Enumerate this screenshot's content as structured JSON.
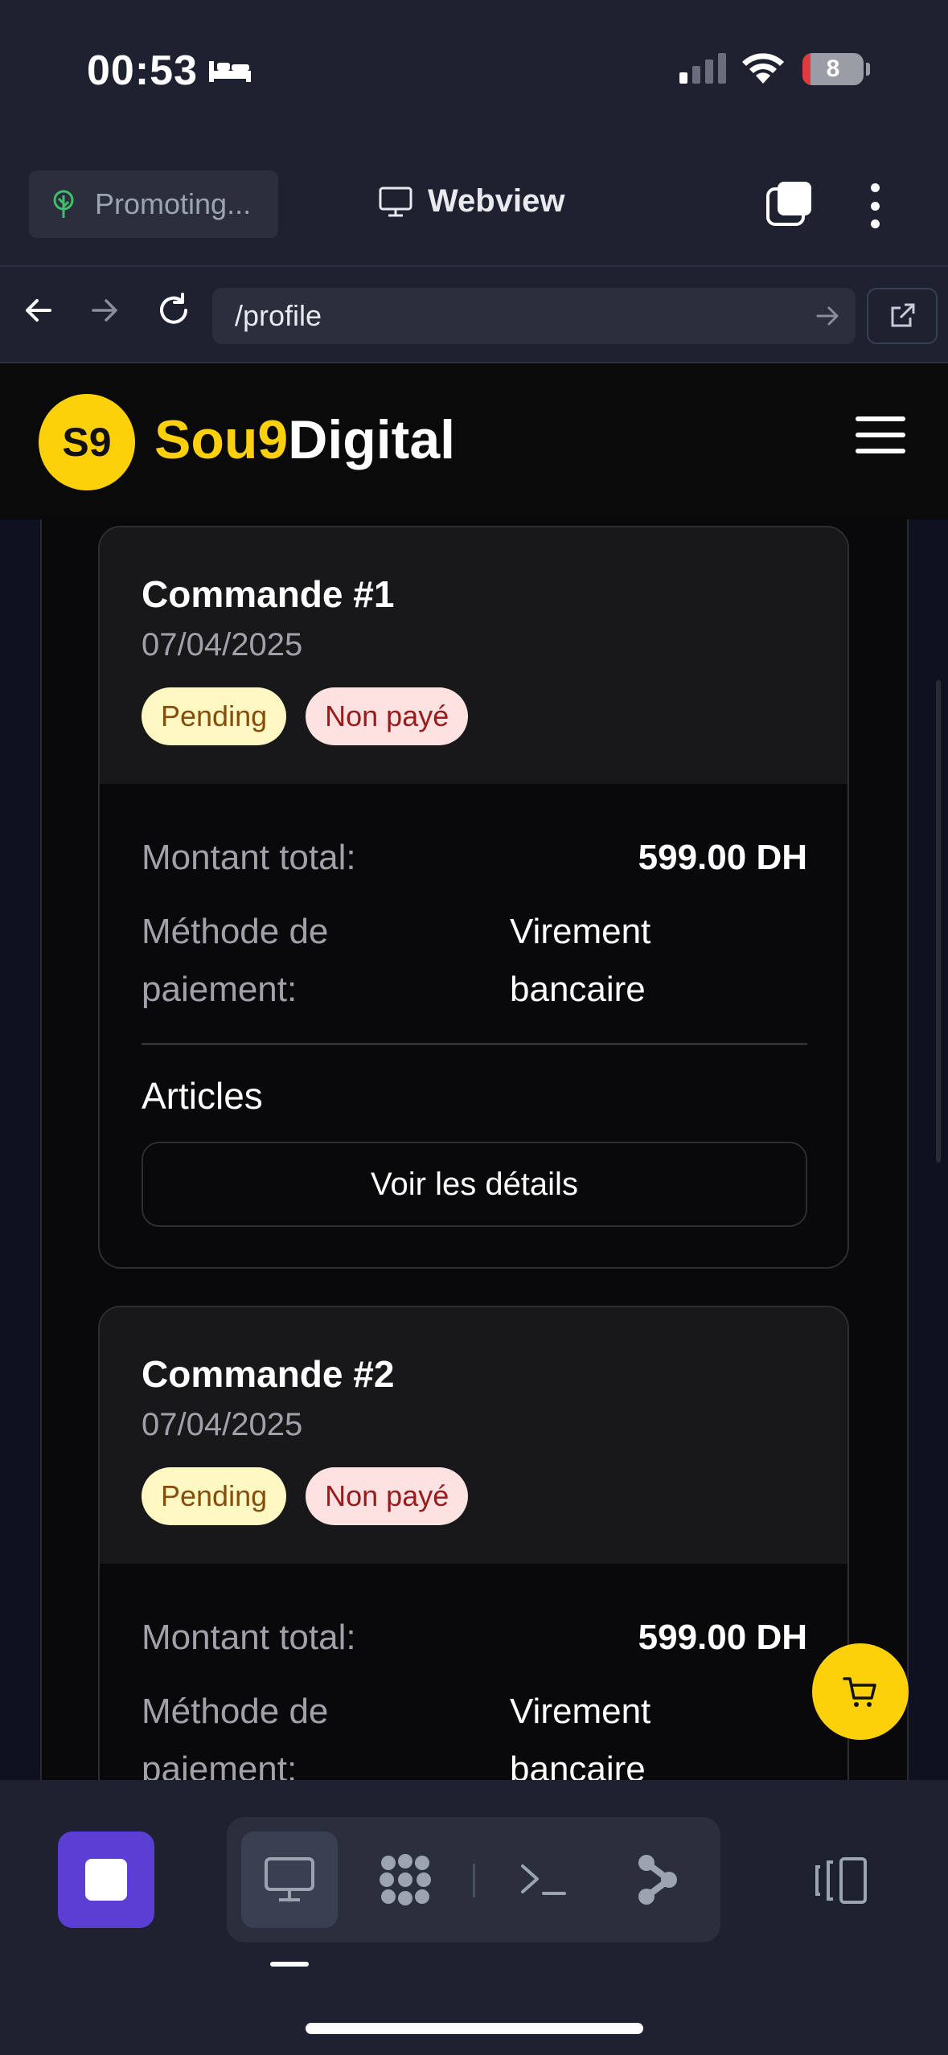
{
  "status_bar": {
    "time": "00:53",
    "battery": "8"
  },
  "toolbar": {
    "promo_label": "Promoting...",
    "webview_label": "Webview"
  },
  "url_bar": {
    "url": "/profile"
  },
  "site": {
    "logo_initials": "S9",
    "brand_part1": "Sou9",
    "brand_part2": "Digital"
  },
  "orders": [
    {
      "title": "Commande #1",
      "date": "07/04/2025",
      "status_badge": "Pending",
      "payment_badge": "Non payé",
      "total_label": "Montant total:",
      "total_value": "599.00 DH",
      "method_label": "Méthode de paiement:",
      "method_value": "Virement bancaire",
      "articles_label": "Articles",
      "details_button": "Voir les détails"
    },
    {
      "title": "Commande #2",
      "date": "07/04/2025",
      "status_badge": "Pending",
      "payment_badge": "Non payé",
      "total_label": "Montant total:",
      "total_value": "599.00 DH",
      "method_label": "Méthode de paiement:",
      "method_value": "Virement bancaire"
    }
  ],
  "colors": {
    "brand_yellow": "#fdd10a",
    "stop_purple": "#5b3fd4",
    "pending_bg": "#fef9c3",
    "unpaid_bg": "#fee2e2"
  },
  "icons": [
    "bed-icon",
    "cellular-signal-icon",
    "wifi-icon",
    "battery-icon",
    "tree-icon",
    "monitor-icon",
    "tabs-icon",
    "more-vertical-icon",
    "back-icon",
    "forward-icon",
    "reload-icon",
    "arrow-right-icon",
    "external-link-icon",
    "menu-icon",
    "cart-icon",
    "stop-icon",
    "apps-grid-icon",
    "terminal-icon",
    "git-branch-icon",
    "split-view-icon"
  ]
}
